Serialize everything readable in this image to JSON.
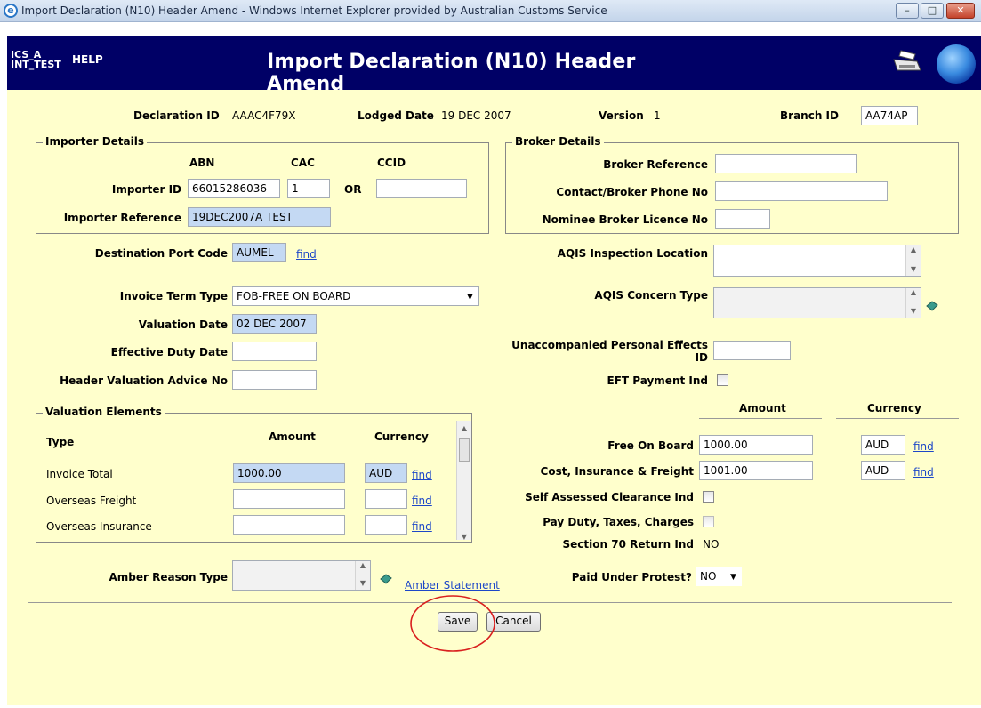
{
  "window": {
    "title": "Import Declaration (N10) Header Amend - Windows Internet Explorer provided by Australian Customs Service",
    "ie_icon": "ie-logo-icon",
    "buttons": [
      "minimize",
      "maximize",
      "close"
    ]
  },
  "header": {
    "env_line1": "ICS_A",
    "env_line2": "INT_TEST",
    "help": "HELP",
    "title": "Import Declaration (N10) Header Amend",
    "icons": [
      "printer-icon",
      "globe-icon"
    ],
    "bg_color": "#000066"
  },
  "summary": {
    "declaration_id_label": "Declaration ID",
    "declaration_id": "AAAC4F79X",
    "lodged_date_label": "Lodged Date",
    "lodged_date": "19 DEC 2007",
    "version_label": "Version",
    "version": "1",
    "branch_id_label": "Branch ID",
    "branch_id": "AA74AP"
  },
  "importer": {
    "legend": "Importer Details",
    "col_abn": "ABN",
    "col_cac": "CAC",
    "col_ccid": "CCID",
    "importer_id_label": "Importer ID",
    "abn": "66015286036",
    "cac": "1",
    "or": "OR",
    "ccid": "",
    "reference_label": "Importer Reference",
    "reference": "19DEC2007A TEST"
  },
  "broker": {
    "legend": "Broker Details",
    "reference_label": "Broker Reference",
    "reference": "",
    "phone_label": "Contact/Broker Phone No",
    "phone": "",
    "licence_label": "Nominee Broker Licence No",
    "licence": ""
  },
  "left_fields": {
    "dest_port_label": "Destination Port Code",
    "dest_port": "AUMEL",
    "find": "find",
    "invoice_term_label": "Invoice Term Type",
    "invoice_term": "FOB-FREE ON BOARD",
    "valuation_date_label": "Valuation Date",
    "valuation_date": "02 DEC 2007",
    "effective_duty_label": "Effective Duty Date",
    "effective_duty": "",
    "hva_label": "Header Valuation Advice No",
    "hva": ""
  },
  "right_fields": {
    "aqis_loc_label": "AQIS Inspection Location",
    "aqis_loc": "",
    "aqis_concern_label": "AQIS Concern Type",
    "aqis_concern": "",
    "upe_label_1": "Unaccompanied Personal Effects",
    "upe_label_2": "ID",
    "upe": "",
    "eft_label": "EFT Payment Ind"
  },
  "valuation": {
    "legend": "Valuation Elements",
    "col_type": "Type",
    "col_amount": "Amount",
    "col_currency": "Currency",
    "rows": [
      {
        "type": "Invoice Total",
        "amount": "1000.00",
        "currency": "AUD",
        "find": "find"
      },
      {
        "type": "Overseas Freight",
        "amount": "",
        "currency": "",
        "find": "find"
      },
      {
        "type": "Overseas Insurance",
        "amount": "",
        "currency": "",
        "find": "find"
      }
    ]
  },
  "totals": {
    "col_amount": "Amount",
    "col_currency": "Currency",
    "fob_label": "Free On Board",
    "fob_amount": "1000.00",
    "fob_currency": "AUD",
    "cif_label": "Cost, Insurance & Freight",
    "cif_amount": "1001.00",
    "cif_currency": "AUD",
    "find": "find",
    "sac_label": "Self Assessed Clearance Ind",
    "paydt_label": "Pay Duty, Taxes, Charges",
    "s70_label": "Section 70 Return Ind",
    "s70": "NO",
    "protest_label": "Paid Under Protest?",
    "protest": "NO"
  },
  "amber": {
    "label": "Amber Reason Type",
    "value": "",
    "statement_link": "Amber Statement"
  },
  "actions": {
    "save": "Save",
    "cancel": "Cancel",
    "annotation_color": "#d9201f"
  }
}
